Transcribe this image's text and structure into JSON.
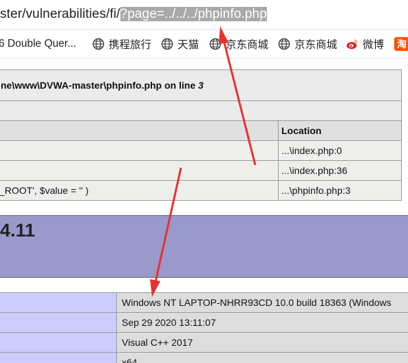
{
  "address_bar": {
    "url_prefix": "ster/vulnerabilities/fi/",
    "url_selected": "?page=../../../phpinfo.php"
  },
  "bookmarks": [
    {
      "label": "6 Double Quer...",
      "icon": "none"
    },
    {
      "label": "携程旅行",
      "icon": "globe-icon"
    },
    {
      "label": "天猫",
      "icon": "globe-icon"
    },
    {
      "label": "京东商城",
      "icon": "globe-icon"
    },
    {
      "label": "京东商城",
      "icon": "globe-icon"
    },
    {
      "label": "微博",
      "icon": "weibo-icon"
    },
    {
      "label": "淘",
      "icon": "taobao-icon"
    }
  ],
  "error_table": {
    "title_prefix": "ne\\www\\DVWA-master\\phpinfo.php on line ",
    "title_line": "3",
    "location_header": "Location",
    "rows": [
      {
        "call": "",
        "location": "...\\index.php:0"
      },
      {
        "call": "",
        "location": "...\\index.php:36"
      },
      {
        "call": "_ROOT', $value = '' )",
        "location": "...\\phpinfo.php:3"
      }
    ]
  },
  "php_banner": {
    "version_text": "4.11"
  },
  "info_table": {
    "rows": [
      {
        "key": "",
        "value": "Windows NT LAPTOP-NHRR93CD 10.0 build 18363 (Windows"
      },
      {
        "key": "",
        "value": "Sep 29 2020 13:11:07"
      },
      {
        "key": "",
        "value": "Visual C++ 2017"
      },
      {
        "key": "",
        "value": "x64"
      }
    ]
  },
  "colors": {
    "selection": "#a9a9a9",
    "banner": "#9999cc",
    "key_cell": "#ccccff",
    "value_cell": "#dddddd",
    "arrow": "#e8322f"
  }
}
